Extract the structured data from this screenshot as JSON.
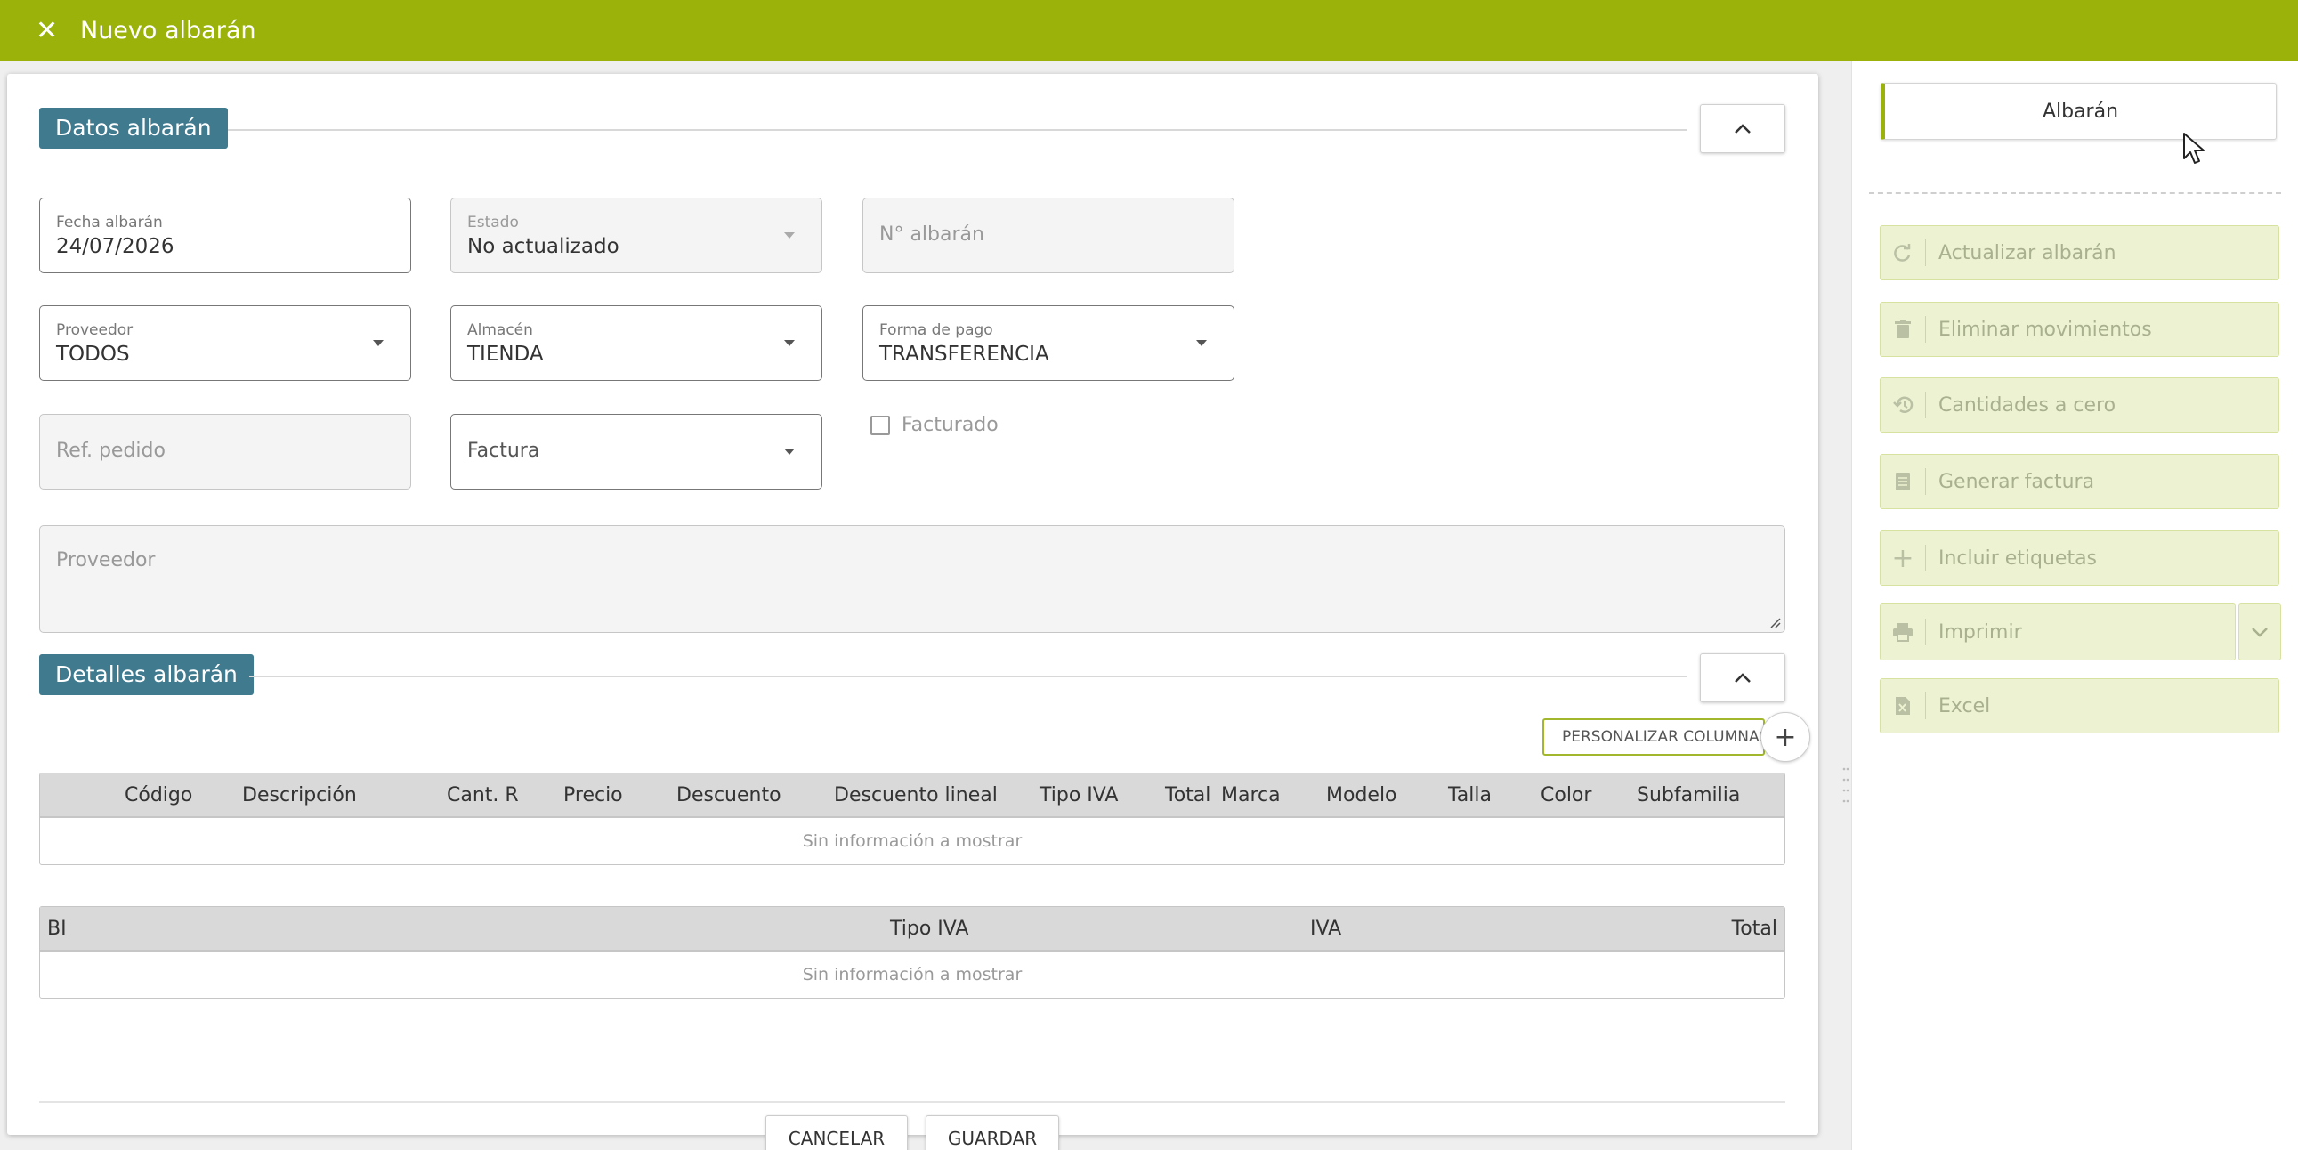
{
  "header": {
    "close_icon": "close-icon",
    "title": "Nuevo albarán"
  },
  "datos": {
    "section_title": "Datos albarán",
    "fecha": {
      "label": "Fecha albarán",
      "value": "24/07/2026"
    },
    "estado": {
      "label": "Estado",
      "value": "No actualizado"
    },
    "numero": {
      "placeholder": "N° albarán"
    },
    "proveedor": {
      "label": "Proveedor",
      "value": "TODOS"
    },
    "almacen": {
      "label": "Almacén",
      "value": "TIENDA"
    },
    "forma_pago": {
      "label": "Forma de pago",
      "value": "TRANSFERENCIA"
    },
    "ref_pedido": {
      "placeholder": "Ref. pedido"
    },
    "factura": {
      "placeholder": "Factura"
    },
    "facturado": {
      "label": "Facturado",
      "checked": false
    },
    "proveedor_text": {
      "placeholder": "Proveedor"
    }
  },
  "detalles": {
    "section_title": "Detalles albarán",
    "personalize_label": "PERSONALIZAR COLUMNAS",
    "add_icon": "plus-icon",
    "columns": [
      "Código",
      "Descripción",
      "Cant. R",
      "Precio",
      "Descuento",
      "Descuento lineal",
      "Tipo IVA",
      "Total",
      "Marca",
      "Modelo",
      "Talla",
      "Color",
      "Subfamilia"
    ],
    "empty_text": "Sin información a mostrar"
  },
  "totales": {
    "columns": [
      "BI",
      "Tipo IVA",
      "IVA",
      "Total"
    ],
    "empty_text": "Sin información a mostrar"
  },
  "footer": {
    "cancel_label": "CANCELAR",
    "save_label": "GUARDAR"
  },
  "sidebar": {
    "albaran_label": "Albarán",
    "actions": [
      {
        "icon": "refresh-icon",
        "label": "Actualizar albarán"
      },
      {
        "icon": "trash-icon",
        "label": "Eliminar movimientos"
      },
      {
        "icon": "history-icon",
        "label": "Cantidades a cero"
      },
      {
        "icon": "invoice-icon",
        "label": "Generar factura"
      },
      {
        "icon": "plus-icon",
        "label": "Incluir etiquetas"
      },
      {
        "icon": "printer-icon",
        "label": "Imprimir"
      },
      {
        "icon": "excel-file-icon",
        "label": "Excel"
      }
    ]
  },
  "colors": {
    "accent": "#9ab20a",
    "section_tag": "#3f7a8f",
    "action_bg": "#edf3d2"
  }
}
